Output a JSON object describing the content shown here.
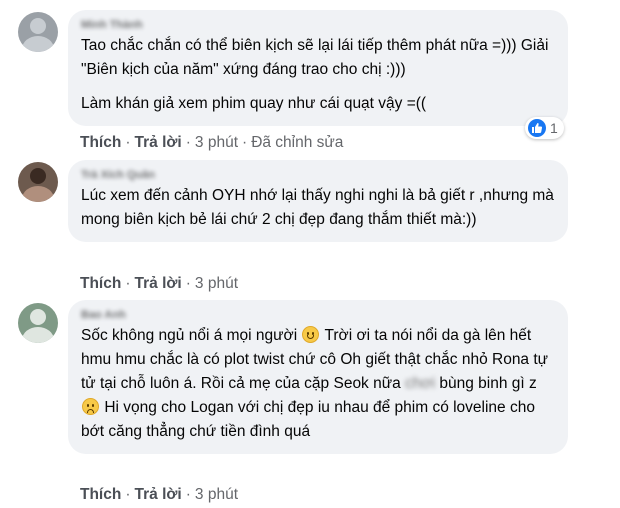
{
  "comments": [
    {
      "author": "Minh Thành",
      "paragraphs": [
        "Tao chắc chắn có thể biên kịch sẽ lại lái tiếp thêm phát nữa =))) Giải \"Biên kịch của năm\" xứng đáng trao cho chị :)))",
        "Làm khán giả xem phim quay như cái quạt vậy =(("
      ],
      "like_label": "Thích",
      "reply_label": "Trả lời",
      "time": "3 phút",
      "edited_label": "Đã chỉnh sửa",
      "reaction_count": "1"
    },
    {
      "author": "Trà Xích Quân",
      "text": "Lúc xem đến cảnh OYH nhớ lại thấy nghi nghi là bả giết r ,nhưng mà mong biên kịch bẻ lái chứ 2 chị đẹp đang thắm thiết mà:))",
      "like_label": "Thích",
      "reply_label": "Trả lời",
      "time": "3 phút"
    },
    {
      "author": "Bao Anh",
      "text_part1": "Sốc không ngủ nổi á mọi người",
      "text_part2": "Trời ơi ta nói nổi da gà lên hết hmu hmu chắc là có plot twist chứ cô Oh giết thật chắc nhỏ Rona tự tử tại chỗ luôn á. Rồi cả mẹ của cặp Seok nữa",
      "blurred_word": "chơi",
      "text_part3": "bùng binh gì z",
      "text_part4": "Hi vọng cho Logan với chị đẹp iu nhau để phim có loveline cho bớt căng thẳng chứ tiền đình quá",
      "emoji_1": "smile-emoji",
      "emoji_2": "sad-emoji",
      "like_label": "Thích",
      "reply_label": "Trả lời",
      "time": "3 phút"
    }
  ],
  "separator": "·",
  "colors": {
    "bubble": "#f0f2f5",
    "like_blue": "#1877f2",
    "meta_gray": "#65676b"
  }
}
